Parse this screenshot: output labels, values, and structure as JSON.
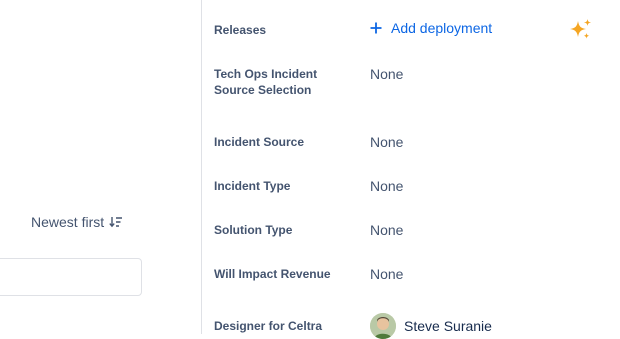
{
  "left_pane": {
    "sort_label": "Newest first",
    "comment_input_placeholder": ""
  },
  "fields": {
    "releases": {
      "label": "Releases",
      "action_label": "Add deployment"
    },
    "tech_ops_incident_source_selection": {
      "label": "Tech Ops Incident Source Selection",
      "value": "None"
    },
    "incident_source": {
      "label": "Incident Source",
      "value": "None"
    },
    "incident_type": {
      "label": "Incident Type",
      "value": "None"
    },
    "solution_type": {
      "label": "Solution Type",
      "value": "None"
    },
    "will_impact_revenue": {
      "label": "Will Impact Revenue",
      "value": "None"
    },
    "designer_for_celtra": {
      "label": "Designer for Celtra",
      "assignee_name": "Steve Suranie"
    }
  },
  "colors": {
    "link_blue": "#0c66e4",
    "sparkle_orange": "#f5a623",
    "label_gray": "#44546f",
    "divider": "#dfe1e6"
  },
  "icons": {
    "sort": "sort-descending-icon",
    "add": "plus-icon",
    "ai": "sparkle-icon"
  }
}
